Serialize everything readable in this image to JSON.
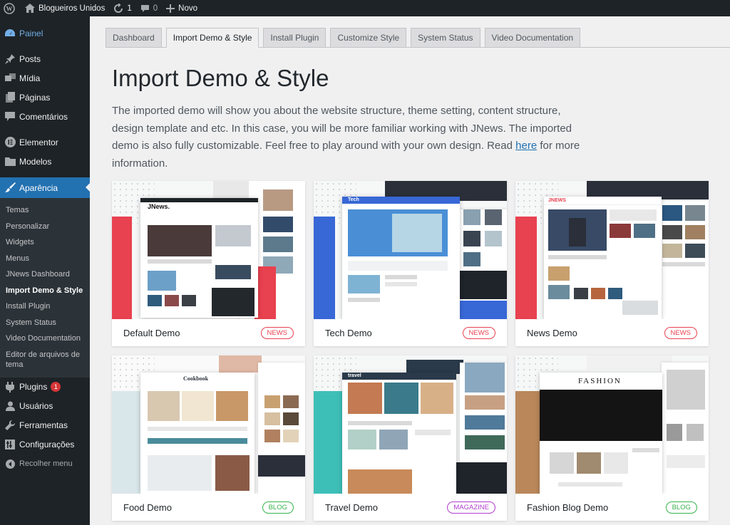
{
  "adminbar": {
    "site_name": "Blogueiros Unidos",
    "updates_count": "1",
    "comments_count": "0",
    "new_label": "Novo"
  },
  "sidebar": {
    "painel": "Painel",
    "posts": "Posts",
    "midia": "Mídia",
    "paginas": "Páginas",
    "comentarios": "Comentários",
    "elementor": "Elementor",
    "modelos": "Modelos",
    "aparencia": "Aparência",
    "sub": [
      "Temas",
      "Personalizar",
      "Widgets",
      "Menus",
      "JNews Dashboard",
      "Import Demo & Style",
      "Install Plugin",
      "System Status",
      "Video Documentation",
      "Editor de arquivos de tema"
    ],
    "plugins": "Plugins",
    "plugins_badge": "1",
    "usuarios": "Usuários",
    "ferramentas": "Ferramentas",
    "configuracoes": "Configurações",
    "recolher": "Recolher menu"
  },
  "tabs": [
    "Dashboard",
    "Import Demo & Style",
    "Install Plugin",
    "Customize Style",
    "System Status",
    "Video Documentation"
  ],
  "page": {
    "title": "Import Demo & Style",
    "desc_before": "The imported demo will show you about the website structure, theme setting, content structure, design template and etc. In this case, you will be more familiar working with JNews. The imported demo is also fully customizable. Feel free to play around with your own design. Read ",
    "desc_link": "here",
    "desc_after": " for more information."
  },
  "demos": [
    {
      "name": "Default Demo",
      "tag": "NEWS",
      "tag_color": "#e8414f",
      "accent": "#e8414f",
      "preview_logo": "JNews."
    },
    {
      "name": "Tech Demo",
      "tag": "NEWS",
      "tag_color": "#e8414f",
      "accent": "#3867d6",
      "preview_logo": "Tech"
    },
    {
      "name": "News Demo",
      "tag": "NEWS",
      "tag_color": "#e8414f",
      "accent": "#e8414f",
      "preview_logo": "JNEWS"
    },
    {
      "name": "Food Demo",
      "tag": "BLOG",
      "tag_color": "#37b24d",
      "accent": "#d9e6ea",
      "preview_logo": "Cookbook"
    },
    {
      "name": "Travel Demo",
      "tag": "MAGAZINE",
      "tag_color": "#b13ccf",
      "accent": "#3dbfb8",
      "preview_logo": "travel"
    },
    {
      "name": "Fashion Blog Demo",
      "tag": "BLOG",
      "tag_color": "#37b24d",
      "accent": "#b9875a",
      "preview_logo": "FASHION"
    }
  ]
}
